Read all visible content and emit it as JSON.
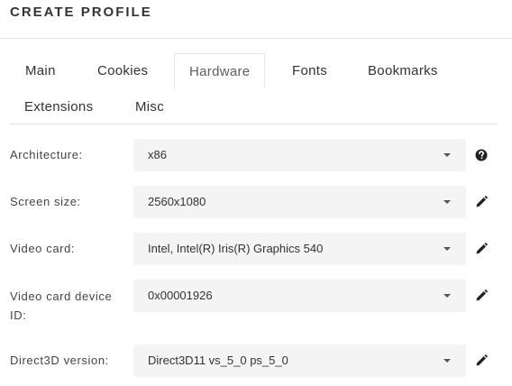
{
  "header": {
    "title": "CREATE PROFILE"
  },
  "tabs": [
    {
      "label": "Main"
    },
    {
      "label": "Cookies"
    },
    {
      "label": "Hardware"
    },
    {
      "label": "Fonts"
    },
    {
      "label": "Bookmarks"
    },
    {
      "label": "Extensions"
    },
    {
      "label": "Misc"
    }
  ],
  "active_tab": "Hardware",
  "fields": [
    {
      "label": "Architecture:",
      "value": "x86",
      "icon": "help-icon"
    },
    {
      "label": "Screen size:",
      "value": "2560x1080",
      "icon": "pencil-icon"
    },
    {
      "label": "Video card:",
      "value": "Intel, Intel(R) Iris(R) Graphics 540",
      "icon": "pencil-icon"
    },
    {
      "label": "Video card device ID:",
      "value": "0x00001926",
      "icon": "pencil-icon"
    },
    {
      "label": "Direct3D version:",
      "value": "Direct3D11 vs_5_0 ps_5_0",
      "icon": "pencil-icon"
    }
  ],
  "colors": {
    "text": "#333333",
    "select_bg": "#f4f4f4",
    "border": "#e6e6e6"
  }
}
